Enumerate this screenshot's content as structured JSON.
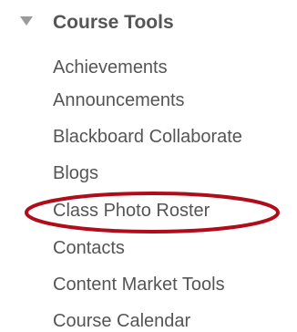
{
  "section": {
    "title": "Course Tools",
    "expanded_icon": "triangle-down-icon"
  },
  "tools": [
    {
      "label": "Achievements"
    },
    {
      "label": "Announcements"
    },
    {
      "label": "Blackboard Collaborate"
    },
    {
      "label": "Blogs"
    },
    {
      "label": "Class Photo Roster"
    },
    {
      "label": "Contacts"
    },
    {
      "label": "Content Market Tools"
    },
    {
      "label": "Course Calendar"
    }
  ],
  "annotation": {
    "highlighted_item": "Class Photo Roster",
    "color": "#b00c1a"
  },
  "colors": {
    "text": "#555555",
    "chevron": "#9a9a9a",
    "background": "#ffffff"
  }
}
